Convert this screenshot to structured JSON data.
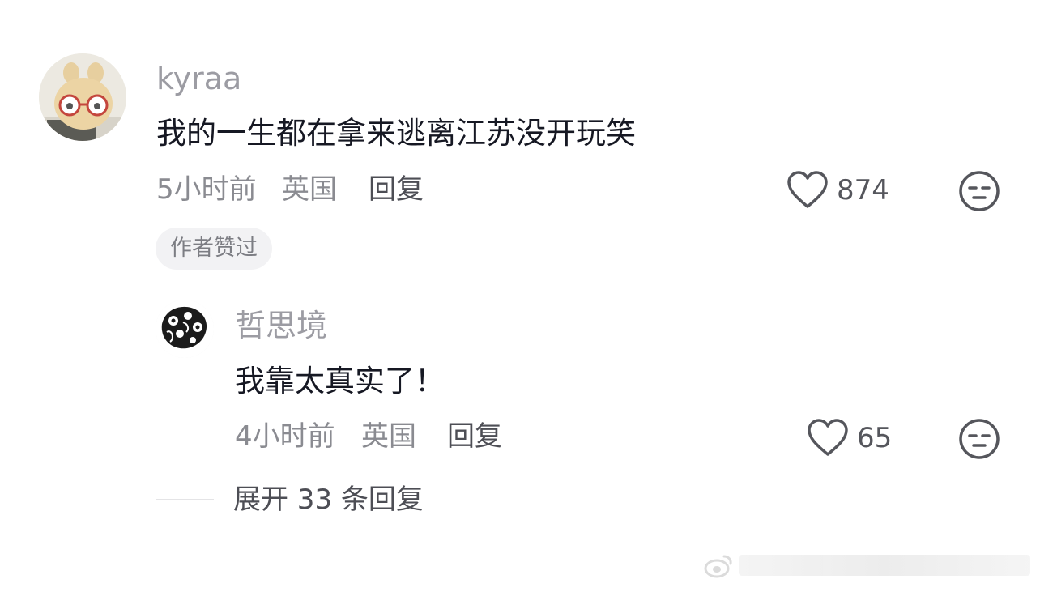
{
  "comment": {
    "username": "kyraa",
    "text": "我的一生都在拿来逃离江苏没开玩笑",
    "time": "5小时前",
    "location": "英国",
    "reply_label": "回复",
    "like_count": "874",
    "badge": "作者赞过"
  },
  "reply": {
    "username": "哲思境",
    "text": "我靠太真实了！",
    "time": "4小时前",
    "location": "英国",
    "reply_label": "回复",
    "like_count": "65"
  },
  "expand": {
    "label": "展开 33 条回复"
  },
  "colors": {
    "username": "#9c9ca3",
    "text": "#161823",
    "meta": "#8a8b91",
    "badge_bg": "#f2f2f4"
  },
  "icons": {
    "like": "heart-outline-icon",
    "dislike": "neutral-face-icon"
  }
}
